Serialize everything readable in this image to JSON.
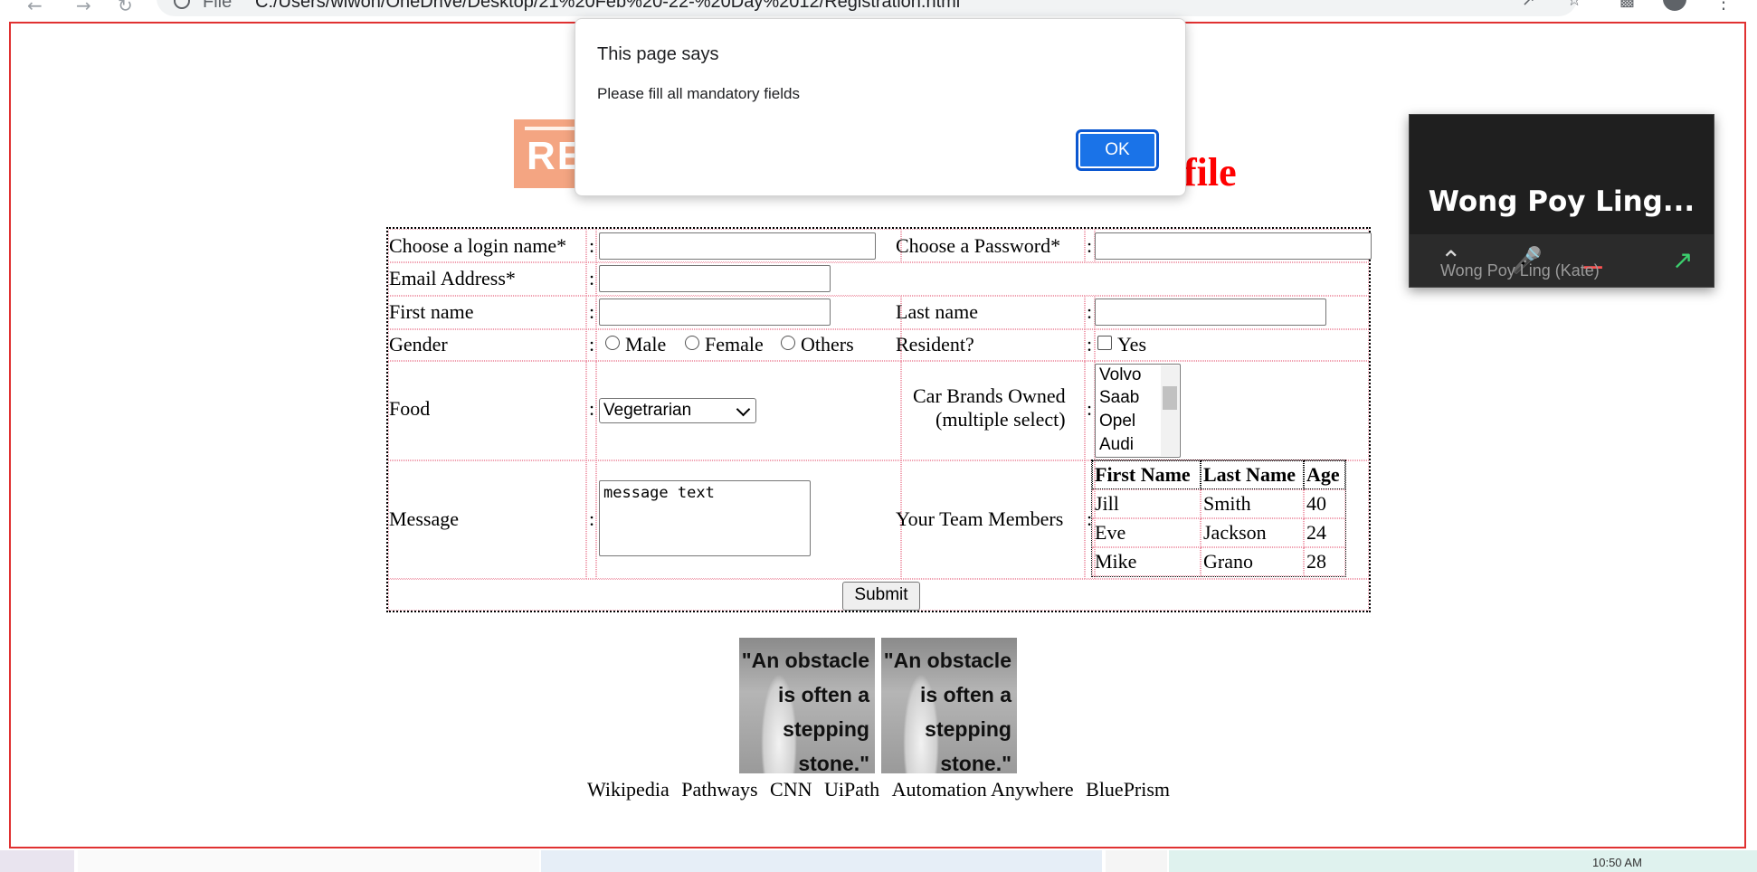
{
  "browser": {
    "file_label": "File",
    "url": "C:/Users/wiwon/OneDrive/Desktop/21%20Feb%20-22-%20Day%2012/Registration.html"
  },
  "page": {
    "heading_logo_text": "REG",
    "heading_tail": "file"
  },
  "form": {
    "login_label": "Choose a login name*",
    "password_label": "Choose a Password*",
    "email_label": "Email Address*",
    "first_name_label": "First name",
    "last_name_label": "Last name",
    "gender_label": "Gender",
    "gender_options": [
      "Male",
      "Female",
      "Others"
    ],
    "resident_label": "Resident?",
    "resident_option": "Yes",
    "food_label": "Food",
    "food_selected": "Vegetrarian",
    "car_label_line1": "Car Brands Owned",
    "car_label_line2": "(multiple select)",
    "car_options": [
      "Volvo",
      "Saab",
      "Opel",
      "Audi"
    ],
    "message_label": "Message",
    "message_value": "message text",
    "team_label": "Your Team Members",
    "submit_label": "Submit",
    "colon": ":"
  },
  "team_table": {
    "headers": [
      "First Name",
      "Last Name",
      "Age"
    ],
    "rows": [
      [
        "Jill",
        "Smith",
        "40"
      ],
      [
        "Eve",
        "Jackson",
        "24"
      ],
      [
        "Mike",
        "Grano",
        "28"
      ]
    ]
  },
  "images": {
    "quote_lines": [
      "\"An obstacle",
      "is often a",
      "stepping",
      "stone.\""
    ]
  },
  "links": [
    "Wikipedia",
    "Pathways",
    "CNN",
    "UiPath",
    "Automation Anywhere",
    "BluePrism"
  ],
  "dialog": {
    "title": "This page says",
    "message": "Please fill all mandatory fields",
    "ok_label": "OK"
  },
  "video": {
    "display_name": "Wong Poy Ling...",
    "participant_label": "Wong Poy Ling (Kate)"
  },
  "taskbar": {
    "clock": "10:50 AM"
  }
}
